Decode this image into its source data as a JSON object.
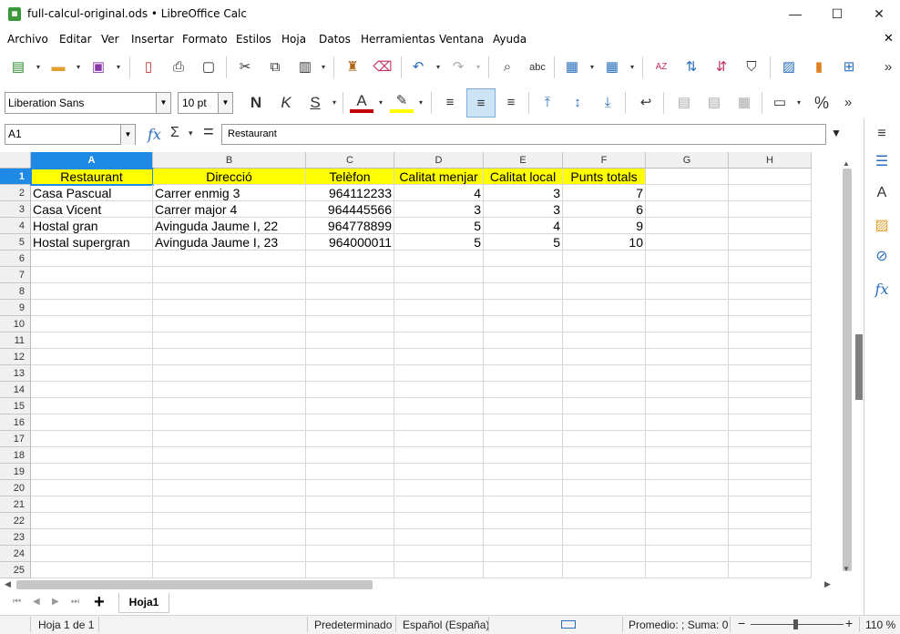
{
  "window": {
    "title": "full-calcul-original.ods • LibreOffice Calc",
    "minimize": "—",
    "maximize": "☐",
    "close": "✕"
  },
  "menu": [
    "Archivo",
    "Editar",
    "Ver",
    "Insertar",
    "Formato",
    "Estilos",
    "Hoja",
    "Datos",
    "Herramientas",
    "Ventana",
    "Ayuda"
  ],
  "menu_close": "✕",
  "format_bar": {
    "font_name": "Liberation Sans",
    "font_size": "10 pt",
    "bold": "N",
    "italic": "K",
    "underline": "S",
    "percent": "%"
  },
  "formula_bar": {
    "cell_ref": "A1",
    "fx": "fx",
    "sum": "Σ",
    "equals": "=",
    "content": "Restaurant"
  },
  "columns": [
    "A",
    "B",
    "C",
    "D",
    "E",
    "F",
    "G",
    "H"
  ],
  "rows": [
    "1",
    "2",
    "3",
    "4",
    "5",
    "6",
    "7",
    "8",
    "9",
    "10",
    "11",
    "12",
    "13",
    "14",
    "15",
    "16",
    "17",
    "18",
    "19",
    "20",
    "21",
    "22",
    "23",
    "24",
    "25"
  ],
  "table": {
    "headers": [
      "Restaurant",
      "Direcció",
      "Telèfon",
      "Calitat menjar",
      "Calitat local",
      "Punts totals"
    ],
    "data": [
      [
        "Casa Pascual",
        "Carrer enmig 3",
        "964112233",
        "4",
        "3",
        "7"
      ],
      [
        "Casa Vicent",
        "Carrer major 4",
        "964445566",
        "3",
        "3",
        "6"
      ],
      [
        "Hostal gran",
        "Avinguda Jaume I, 22",
        "964778899",
        "5",
        "4",
        "9"
      ],
      [
        "Hostal supergran",
        "Avinguda Jaume I, 23",
        "964000011",
        "5",
        "5",
        "10"
      ]
    ]
  },
  "sheet_tabs": {
    "add": "+",
    "tabs": [
      "Hoja1"
    ]
  },
  "status": {
    "sheet": "Hoja 1 de 1",
    "style": "Predeterminado",
    "language": "Español (España)",
    "summary": "Promedio: ; Suma: 0",
    "zoom": "110 %",
    "zoom_minus": "−",
    "zoom_plus": "+"
  },
  "colors": {
    "selection": "#1e8ae6",
    "header_fill": "#ffff00",
    "spell_underline": "#d02020"
  }
}
